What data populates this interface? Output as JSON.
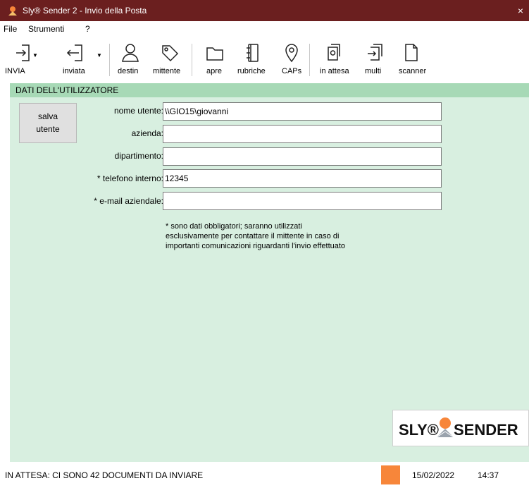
{
  "window": {
    "title": "Sly® Sender 2 - Invio della Posta",
    "close_glyph": "×"
  },
  "menu": [
    "File",
    "Strumenti",
    "?"
  ],
  "toolbar": {
    "invia": "INVIA",
    "inviata": "inviata",
    "destin": "destin",
    "mittente": "mittente",
    "apre": "apre",
    "rubriche": "rubriche",
    "caps": "CAPs",
    "in_attesa": "in attesa",
    "multi": "multi",
    "scanner": "scanner",
    "dropdown_glyph": "▼"
  },
  "section": {
    "title": "DATI DELL'UTILIZZATORE"
  },
  "form": {
    "save_label_line1": "salva",
    "save_label_line2": "utente",
    "fields": [
      {
        "label": "nome utente:",
        "value": "\\\\GIO15\\giovanni"
      },
      {
        "label": "azienda:",
        "value": ""
      },
      {
        "label": "dipartimento:",
        "value": ""
      },
      {
        "label": "* telefono interno:",
        "value": "12345"
      },
      {
        "label": "* e-mail aziendale:",
        "value": ""
      }
    ],
    "note": "* sono dati obbligatori; saranno utilizzati esclusivamente per contattare il mittente in caso di importanti comunicazioni riguardanti l'invio effettuato"
  },
  "logo": {
    "text_left": "SLY®",
    "text_right": "SENDER"
  },
  "status": {
    "message": "IN ATTESA: CI SONO 42 DOCUMENTI DA INVIARE",
    "indicator_color": "#f7863a",
    "date": "15/02/2022",
    "time": "14:37"
  },
  "colors": {
    "titlebar": "#6b1f1f",
    "section_header": "#a7d9b6",
    "panel": "#d8efe0"
  }
}
